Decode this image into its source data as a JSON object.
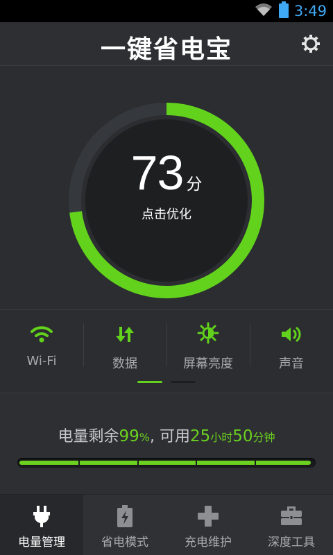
{
  "status_bar": {
    "time": "3:49",
    "icons": [
      "wifi-icon",
      "battery-icon"
    ],
    "time_color": "#3fa9f5"
  },
  "header": {
    "title": "一键省电宝",
    "settings_icon": "gear-icon"
  },
  "score": {
    "value": "73",
    "unit": "分",
    "progress_percent": 73,
    "action_label": "点击优化",
    "accent_color": "#62d21c"
  },
  "toggles": [
    {
      "icon": "wifi-icon",
      "label": "Wi-Fi",
      "on": true
    },
    {
      "icon": "data-transfer-icon",
      "label": "数据",
      "on": true
    },
    {
      "icon": "brightness-icon",
      "label": "屏幕亮度",
      "on": true
    },
    {
      "icon": "volume-icon",
      "label": "声音",
      "on": true
    }
  ],
  "pager": {
    "pages": 2,
    "active": 1
  },
  "battery": {
    "prefix": "电量剩余",
    "percent": "99",
    "percent_sign": "%",
    "middle": ", 可用",
    "hours": "25",
    "hours_unit": "小时",
    "minutes": "50",
    "minutes_unit": "分钟",
    "level": 0.99,
    "segments": 5
  },
  "nav": [
    {
      "icon": "plug-icon",
      "label": "电量管理",
      "active": true
    },
    {
      "icon": "battery-charge-icon",
      "label": "省电模式",
      "active": false
    },
    {
      "icon": "plus-icon",
      "label": "充电维护",
      "active": false
    },
    {
      "icon": "toolbox-icon",
      "label": "深度工具",
      "active": false
    }
  ]
}
